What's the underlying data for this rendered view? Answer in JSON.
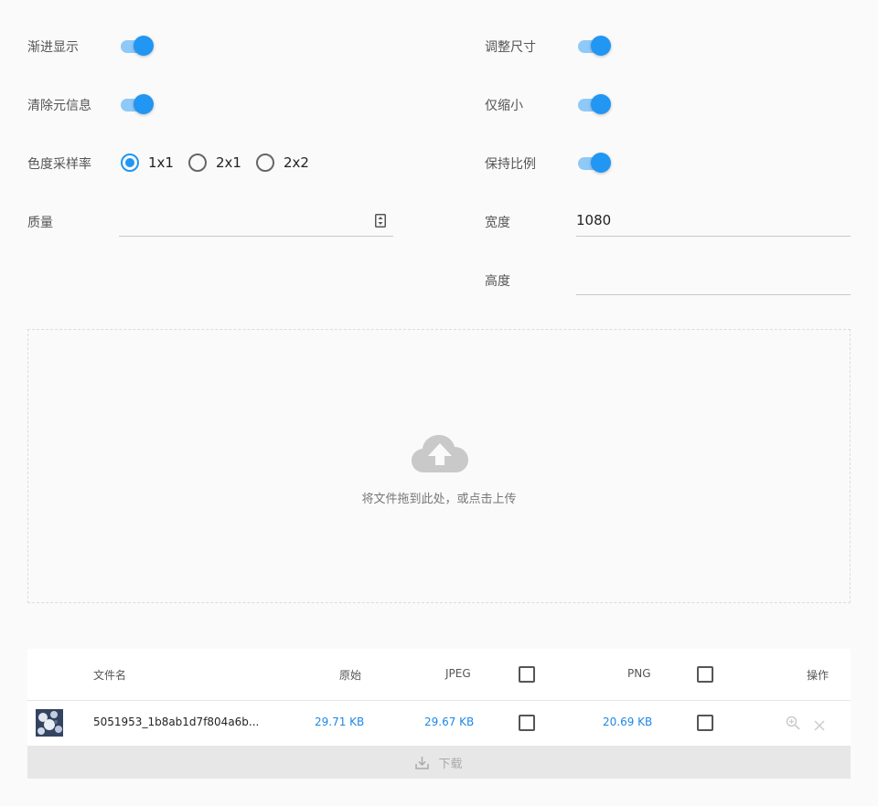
{
  "options": {
    "progressive": "渐进显示",
    "strip_metadata": "清除元信息",
    "chroma_subsampling": "色度采样率",
    "quality": "质量",
    "resize": "调整尺寸",
    "shrink_only": "仅缩小",
    "keep_ratio": "保持比例",
    "width": "宽度",
    "height": "高度"
  },
  "chroma_options": [
    "1x1",
    "2x1",
    "2x2"
  ],
  "inputs": {
    "quality_value": "",
    "width_value": "1080",
    "height_value": ""
  },
  "dropzone": {
    "hint": "将文件拖到此处，或点击上传"
  },
  "table": {
    "headers": {
      "filename": "文件名",
      "original": "原始",
      "jpeg": "JPEG",
      "png": "PNG",
      "actions": "操作"
    },
    "rows": [
      {
        "filename": "5051953_1b8ab1d7f804a6b...",
        "original": "29.71 KB",
        "jpeg": "29.67 KB",
        "png": "20.69 KB"
      }
    ],
    "download": "下载"
  },
  "colors": {
    "accent": "#2196f3",
    "size_text": "#1e88e5"
  }
}
